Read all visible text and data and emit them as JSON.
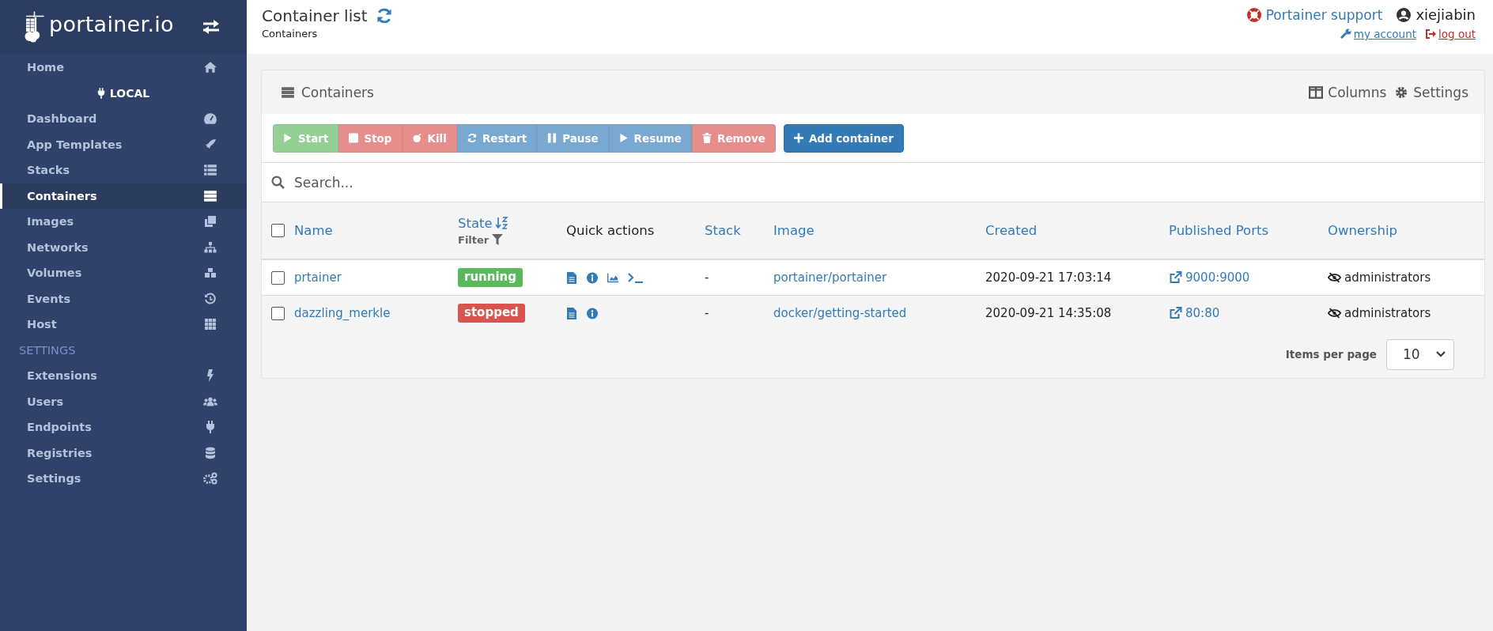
{
  "sidebar": {
    "logo": "portainer.io",
    "items": [
      {
        "kind": "link",
        "label": "Home",
        "selected": false
      },
      {
        "kind": "endpoint",
        "label": "LOCAL",
        "selected": false
      },
      {
        "kind": "link",
        "label": "Dashboard",
        "selected": false
      },
      {
        "kind": "link",
        "label": "App Templates",
        "selected": false
      },
      {
        "kind": "link",
        "label": "Stacks",
        "selected": false
      },
      {
        "kind": "link",
        "label": "Containers",
        "selected": true
      },
      {
        "kind": "link",
        "label": "Images",
        "selected": false
      },
      {
        "kind": "link",
        "label": "Networks",
        "selected": false
      },
      {
        "kind": "link",
        "label": "Volumes",
        "selected": false
      },
      {
        "kind": "link",
        "label": "Events",
        "selected": false
      },
      {
        "kind": "link",
        "label": "Host",
        "selected": false
      },
      {
        "kind": "section",
        "label": "SETTINGS",
        "selected": false
      },
      {
        "kind": "link",
        "label": "Extensions",
        "selected": false
      },
      {
        "kind": "link",
        "label": "Users",
        "selected": false
      },
      {
        "kind": "link",
        "label": "Endpoints",
        "selected": false
      },
      {
        "kind": "link",
        "label": "Registries",
        "selected": false
      },
      {
        "kind": "link",
        "label": "Settings",
        "selected": false
      }
    ]
  },
  "header": {
    "title": "Container list",
    "breadcrumb": "Containers",
    "support": "Portainer support",
    "user": "xiejiabin",
    "my_account": "my account",
    "log_out": "log out"
  },
  "panel": {
    "title": "Containers",
    "columns_button": "Columns",
    "settings_button": "Settings",
    "actions": [
      {
        "kind": "success",
        "label": "Start",
        "disabled": true
      },
      {
        "kind": "danger",
        "label": "Stop",
        "disabled": true
      },
      {
        "kind": "danger",
        "label": "Kill",
        "disabled": true
      },
      {
        "kind": "primary",
        "label": "Restart",
        "disabled": true
      },
      {
        "kind": "primary",
        "label": "Pause",
        "disabled": true
      },
      {
        "kind": "primary",
        "label": "Resume",
        "disabled": true
      },
      {
        "kind": "danger",
        "label": "Remove",
        "disabled": true
      }
    ],
    "add_button": "Add container",
    "search": {
      "placeholder": "Search..."
    },
    "table": {
      "select_all": {
        "checked": false
      },
      "columns": [
        {
          "label": "Name"
        },
        {
          "label": "State",
          "sortable": true,
          "filter": "Filter"
        },
        {
          "label": "Quick actions"
        },
        {
          "label": "Stack"
        },
        {
          "label": "Image"
        },
        {
          "label": "Created"
        },
        {
          "label": "Published Ports"
        },
        {
          "label": "Ownership"
        }
      ],
      "rows": [
        {
          "checked": false,
          "name": "prtainer",
          "state": "running",
          "kind": "running",
          "actions": [
            {
              "kind": "logs"
            },
            {
              "kind": "inspect"
            },
            {
              "kind": "stats"
            },
            {
              "kind": "console"
            }
          ],
          "stack": "-",
          "image": "portainer/portainer",
          "created": "2020-09-21 17:03:14",
          "ports": "9000:9000",
          "ownership": "administrators"
        },
        {
          "checked": false,
          "name": "dazzling_merkle",
          "state": "stopped",
          "kind": "stopped",
          "actions": [
            {
              "kind": "logs"
            },
            {
              "kind": "inspect"
            }
          ],
          "stack": "-",
          "image": "docker/getting-started",
          "created": "2020-09-21 14:35:08",
          "ports": "80:80",
          "ownership": "administrators"
        }
      ]
    },
    "items_per_page": {
      "label": "Items per page",
      "value": "10"
    }
  }
}
